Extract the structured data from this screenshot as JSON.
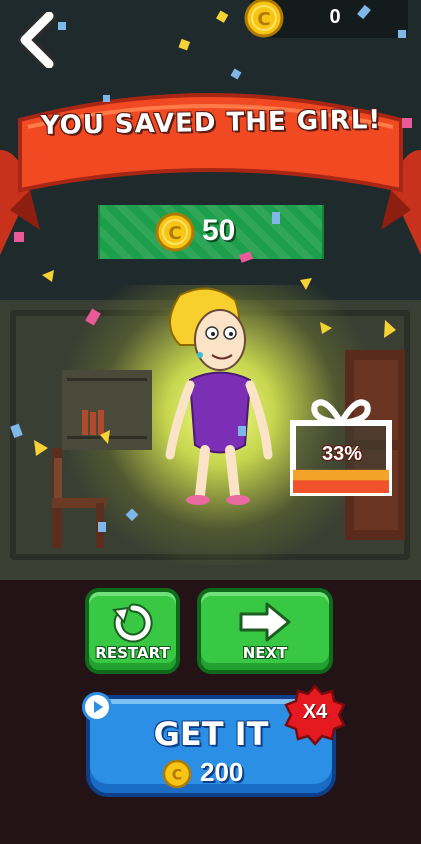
{
  "header": {
    "coin_count": "0"
  },
  "banner": {
    "title": "YOU SAVED THE GIRL!"
  },
  "reward": {
    "amount": "50"
  },
  "gift": {
    "progress_percent": 33,
    "progress_label": "33%"
  },
  "buttons": {
    "restart_label": "RESTART",
    "next_label": "NEXT",
    "get_it_label": "GET IT",
    "get_it_price": "200",
    "multiplier": "X4"
  },
  "colors": {
    "ribbon": "#f14a22",
    "green_button": "#38c844",
    "blue_button": "#2c8fe6",
    "coin": "#f9c514",
    "badge_red": "#e51a21"
  },
  "icons": [
    "back-arrow-icon",
    "coin-icon",
    "restart-icon",
    "next-arrow-icon",
    "video-play-icon",
    "gift-icon"
  ]
}
